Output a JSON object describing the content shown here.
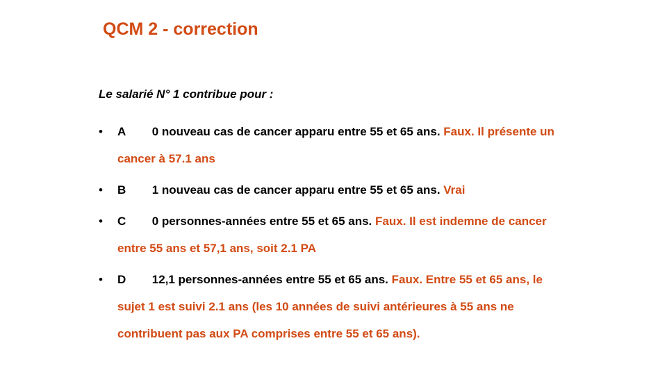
{
  "slide": {
    "title": "QCM 2 - correction",
    "intro": "Le salarié N° 1 contribue pour :",
    "bullet_char": "•",
    "options": [
      {
        "letter": "A",
        "statement": "0 nouveau cas de cancer apparu entre 55 et 65 ans.",
        "verdict": "Faux. Il présente un cancer à 57.1 ans"
      },
      {
        "letter": "B",
        "statement": "1 nouveau cas de cancer apparu entre 55 et 65 ans.",
        "verdict": "Vrai"
      },
      {
        "letter": "C",
        "statement": "0 personnes-années entre 55 et 65 ans.",
        "verdict": "Faux. Il est indemne de cancer entre 55 ans et 57,1 ans, soit 2.1 PA"
      },
      {
        "letter": "D",
        "statement": "12,1 personnes-années entre 55 et 65 ans.",
        "verdict": "Faux. Entre 55 et 65 ans, le sujet 1 est suivi 2.1 ans (les 10 années de suivi antérieures à 55 ans ne contribuent pas aux PA comprises entre 55 et 65 ans)."
      }
    ],
    "colors": {
      "accent": "#d24a14",
      "text": "#000000",
      "background": "#ffffff"
    }
  }
}
